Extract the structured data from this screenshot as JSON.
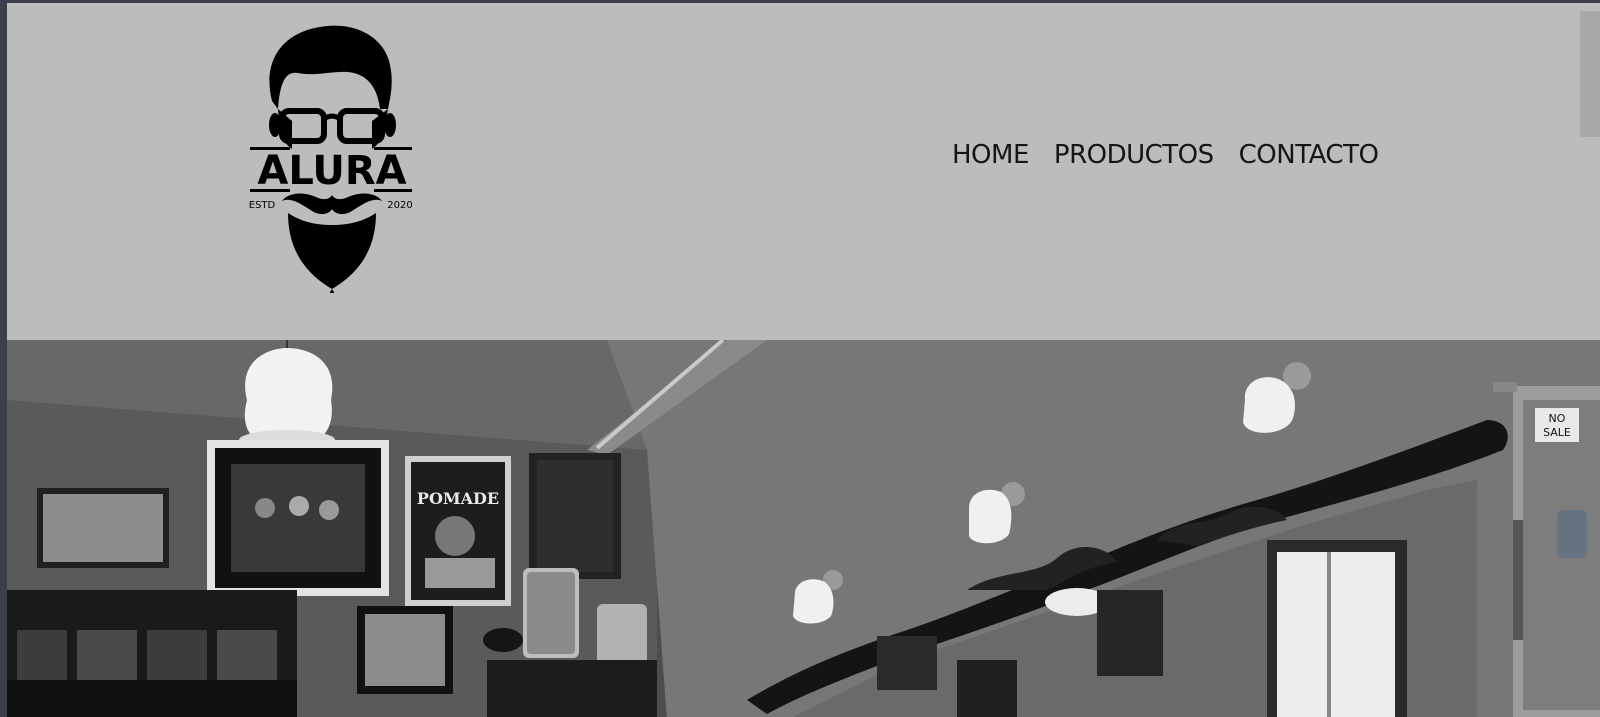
{
  "brand": {
    "name": "ALURA",
    "estd_label": "ESTD",
    "year": "2020",
    "icon": "bearded-man-glasses-logo"
  },
  "nav": {
    "items": [
      {
        "label": "HOME"
      },
      {
        "label": "PRODUCTOS"
      },
      {
        "label": "CONTACTO"
      }
    ]
  },
  "hero": {
    "image": "barbershop-interior-photo",
    "pomade_sign": "POMADE",
    "no_sale_sign_line1": "NO",
    "no_sale_sign_line2": "SALE"
  },
  "colors": {
    "header_bg": "#bcbcbc",
    "nav_text": "#151515",
    "window_border": "#3a3f4a"
  }
}
